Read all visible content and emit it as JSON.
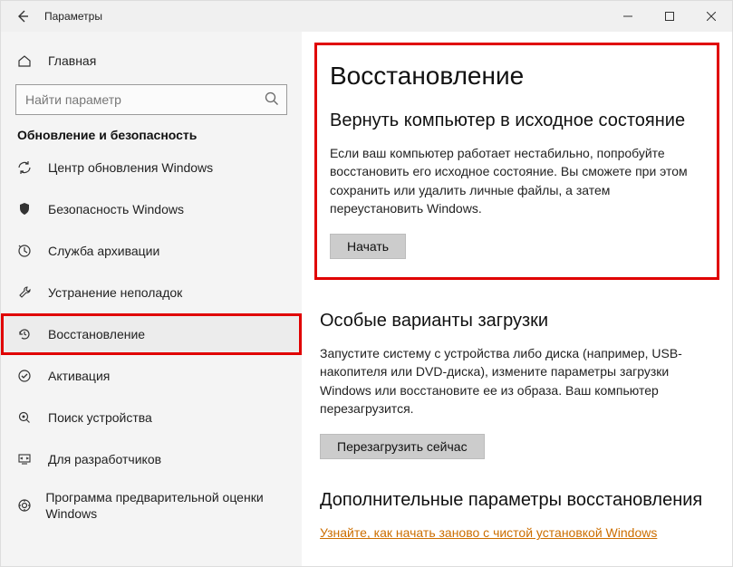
{
  "titlebar": {
    "back_icon": "arrow-left",
    "title": "Параметры"
  },
  "sidebar": {
    "home_label": "Главная",
    "search_placeholder": "Найти параметр",
    "group_label": "Обновление и безопасность",
    "items": [
      {
        "icon": "sync",
        "label": "Центр обновления Windows"
      },
      {
        "icon": "shield",
        "label": "Безопасность Windows"
      },
      {
        "icon": "backup",
        "label": "Служба архивации"
      },
      {
        "icon": "wrench",
        "label": "Устранение неполадок"
      },
      {
        "icon": "history",
        "label": "Восстановление"
      },
      {
        "icon": "check",
        "label": "Активация"
      },
      {
        "icon": "find",
        "label": "Поиск устройства"
      },
      {
        "icon": "developer",
        "label": "Для разработчиков"
      },
      {
        "icon": "insider",
        "label": "Программа предварительной оценки Windows"
      }
    ],
    "selected_index": 4
  },
  "content": {
    "page_title": "Восстановление",
    "reset": {
      "heading": "Вернуть компьютер в исходное состояние",
      "text": "Если ваш компьютер работает нестабильно, попробуйте восстановить его исходное состояние. Вы сможете при этом сохранить или удалить личные файлы, а затем переустановить Windows.",
      "button": "Начать"
    },
    "advanced": {
      "heading": "Особые варианты загрузки",
      "text": "Запустите систему с устройства либо диска (например, USB-накопителя или DVD-диска), измените параметры загрузки Windows или восстановите ее из образа. Ваш компьютер перезагрузится.",
      "button": "Перезагрузить сейчас"
    },
    "more": {
      "heading": "Дополнительные параметры восстановления",
      "link": "Узнайте, как начать заново с чистой установкой Windows"
    }
  }
}
